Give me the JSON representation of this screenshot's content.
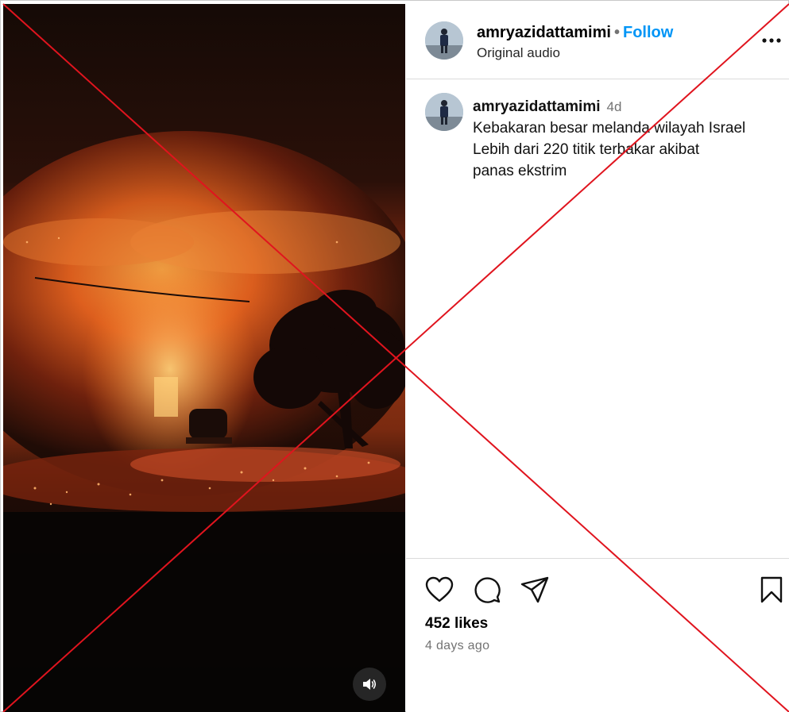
{
  "post": {
    "username": "amryazidattamimi",
    "separator": "•",
    "follow_label": "Follow",
    "audio_label": "Original audio",
    "more_icon": "more-horizontal-icon"
  },
  "caption": {
    "username": "amryazidattamimi",
    "time": "4d",
    "lines": [
      "Kebakaran besar melanda wilayah Israel",
      "Lebih dari 220 titik terbakar akibat",
      "panas ekstrim"
    ]
  },
  "actions": {
    "icons": [
      "heart-icon",
      "comment-icon",
      "share-icon",
      "bookmark-icon"
    ]
  },
  "stats": {
    "likes": "452 likes",
    "posted": "4 days ago"
  },
  "media": {
    "type": "video",
    "mute_icon": "speaker-icon"
  },
  "overlay": {
    "mark": "red-x",
    "color": "#e0141e"
  }
}
